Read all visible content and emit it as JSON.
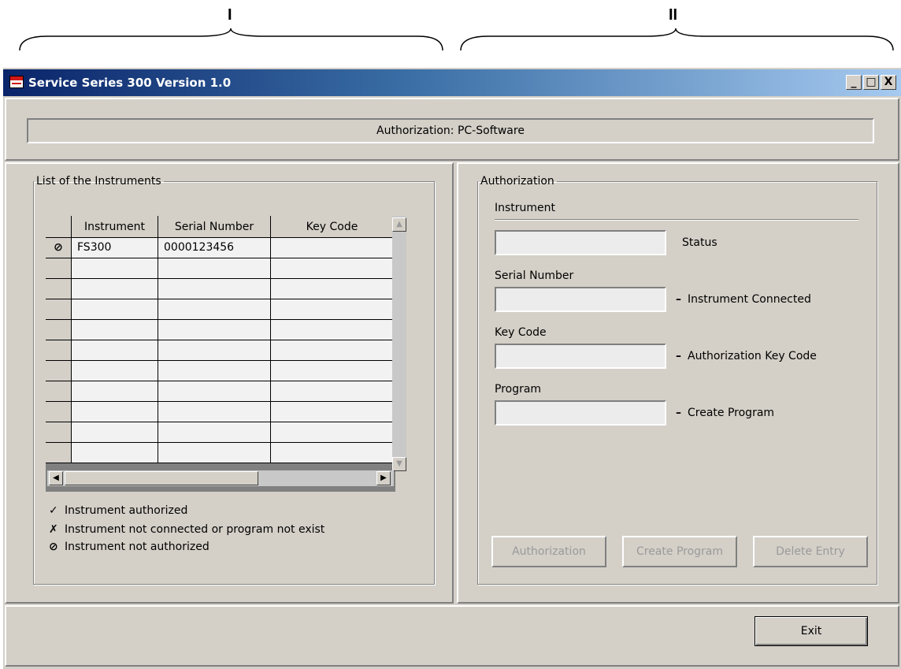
{
  "annotations": {
    "section_left": "I",
    "section_right": "II"
  },
  "window": {
    "title": "Service Series 300 Version 1.0",
    "minimize": "_",
    "maximize": "□",
    "close": "X"
  },
  "authorization_banner": "Authorization: PC-Software",
  "instruments_panel": {
    "group_title": "List of the Instruments",
    "columns": [
      "Instrument",
      "Serial Number",
      "Key Code"
    ],
    "rows": [
      {
        "status": "⊘",
        "instrument": "FS300",
        "serial": "0000123456",
        "key_code": ""
      },
      {
        "status": "",
        "instrument": "",
        "serial": "",
        "key_code": ""
      },
      {
        "status": "",
        "instrument": "",
        "serial": "",
        "key_code": ""
      },
      {
        "status": "",
        "instrument": "",
        "serial": "",
        "key_code": ""
      },
      {
        "status": "",
        "instrument": "",
        "serial": "",
        "key_code": ""
      },
      {
        "status": "",
        "instrument": "",
        "serial": "",
        "key_code": ""
      },
      {
        "status": "",
        "instrument": "",
        "serial": "",
        "key_code": ""
      },
      {
        "status": "",
        "instrument": "",
        "serial": "",
        "key_code": ""
      },
      {
        "status": "",
        "instrument": "",
        "serial": "",
        "key_code": ""
      },
      {
        "status": "",
        "instrument": "",
        "serial": "",
        "key_code": ""
      },
      {
        "status": "",
        "instrument": "",
        "serial": "",
        "key_code": ""
      }
    ],
    "legend": [
      {
        "symbol": "✓",
        "text": "Instrument authorized"
      },
      {
        "symbol": "✗",
        "text": "Instrument not connected or program not exist"
      },
      {
        "symbol": "⊘",
        "text": "Instrument not authorized"
      }
    ]
  },
  "authorization_panel": {
    "group_title": "Authorization",
    "instrument_label": "Instrument",
    "status_label": "Status",
    "serial_label": "Serial Number",
    "serial_hint": "Instrument Connected",
    "key_label": "Key Code",
    "key_hint": "Authorization Key Code",
    "program_label": "Program",
    "program_hint": "Create Program",
    "fields": {
      "status": "",
      "serial": "",
      "key_code": "",
      "program": ""
    },
    "buttons": {
      "authorize": "Authorization",
      "create_program": "Create Program",
      "delete_entry": "Delete Entry"
    }
  },
  "footer": {
    "exit": "Exit"
  }
}
